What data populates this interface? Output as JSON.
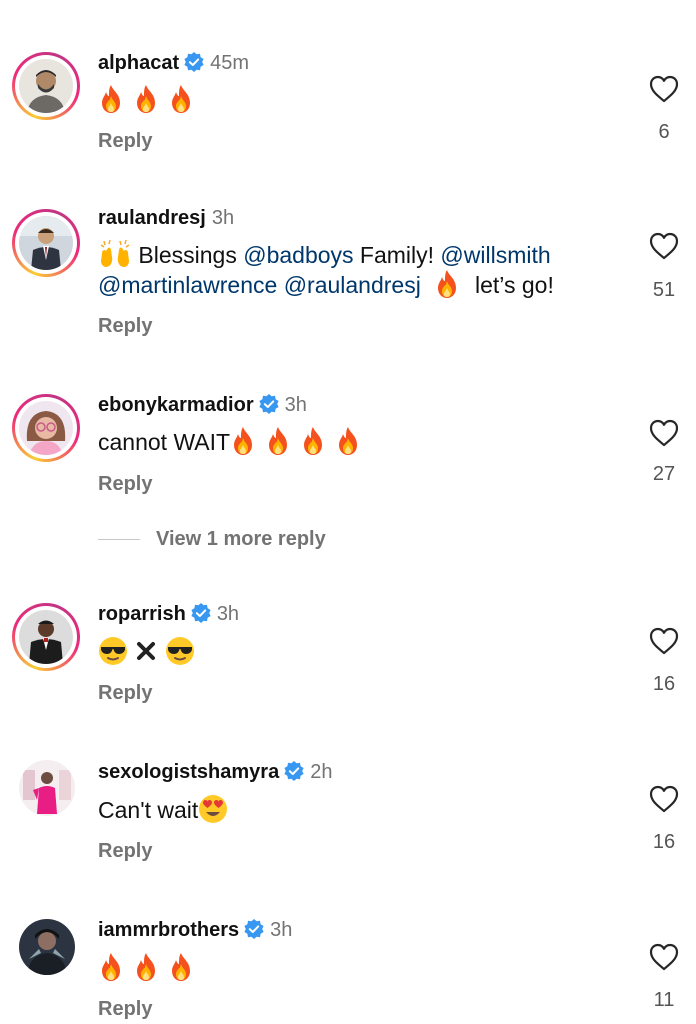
{
  "reply_label": "Reply",
  "view_more_label": "View 1 more reply",
  "comments": [
    {
      "username": "alphacat",
      "verified": true,
      "time": "45m",
      "text_prefix": "",
      "likes": "6",
      "avatar": "man-beard"
    },
    {
      "username": "raulandresj",
      "verified": false,
      "time": "3h",
      "line1": {
        "t1": "Blessings ",
        "m1": "@badboys",
        "t2": " Family! ",
        "m2": "@willsmith"
      },
      "line2": {
        "m1": "@martinlawrence",
        "m2": "@raulandresj",
        "t1": "let’s go!"
      },
      "likes": "51",
      "avatar": "man-suit"
    },
    {
      "username": "ebonykarmadior",
      "verified": true,
      "time": "3h",
      "text_prefix": "cannot WAIT",
      "likes": "27",
      "avatar": "woman-glasses"
    },
    {
      "username": "roparrish",
      "verified": true,
      "time": "3h",
      "likes": "16",
      "avatar": "man-tux"
    },
    {
      "username": "sexologistshamyra",
      "verified": true,
      "time": "2h",
      "text_prefix": "Can't wait",
      "likes": "16",
      "avatar": "woman-pink"
    },
    {
      "username": "iammrbrothers",
      "verified": true,
      "time": "3h",
      "likes": "11",
      "avatar": "man-dark"
    }
  ],
  "colors": {
    "mention": "#00376b",
    "muted": "#737373",
    "verified": "#3897f0",
    "ring_start": "#f9ce34",
    "ring_end": "#c13584"
  }
}
